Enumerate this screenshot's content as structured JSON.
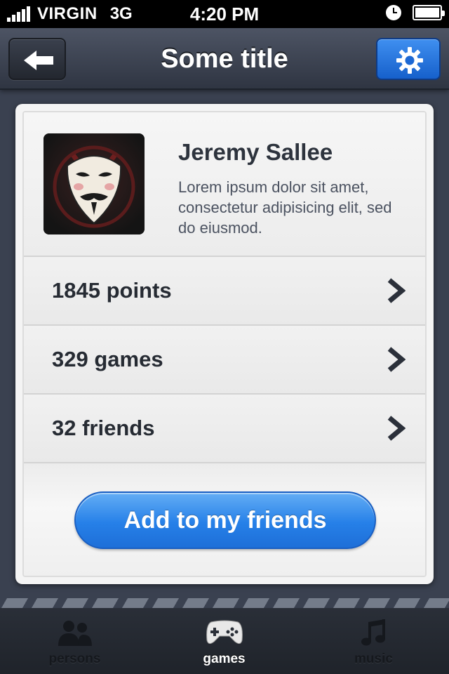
{
  "status_bar": {
    "carrier": "VIRGIN",
    "network": "3G",
    "time": "4:20 PM"
  },
  "nav": {
    "title": "Some title",
    "back_icon": "arrow-left-icon",
    "settings_icon": "gear-icon"
  },
  "profile": {
    "name": "Jeremy Sallee",
    "bio": "Lorem ipsum dolor sit amet, consectetur adipisicing elit, sed do eiusmod.",
    "avatar_icon": "mask-avatar"
  },
  "stats": [
    {
      "label": "1845 points"
    },
    {
      "label": "329 games"
    },
    {
      "label": "32 friends"
    }
  ],
  "action": {
    "label": "Add to my friends"
  },
  "tabs": [
    {
      "label": "persons",
      "icon": "persons-icon",
      "active": false
    },
    {
      "label": "games",
      "icon": "gamepad-icon",
      "active": true
    },
    {
      "label": "music",
      "icon": "music-note-icon",
      "active": false
    }
  ],
  "colors": {
    "accent_blue": "#2680e8",
    "background": "#3a4150",
    "card": "#efefef",
    "text_dark": "#262b33"
  }
}
